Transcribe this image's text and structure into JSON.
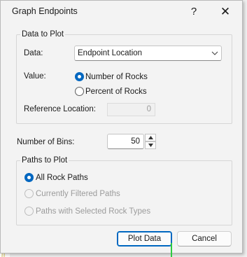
{
  "dialog": {
    "title": "Graph Endpoints",
    "help_glyph": "?",
    "close_glyph": "✕"
  },
  "data_to_plot": {
    "group_label": "Data to Plot",
    "data_label": "Data:",
    "data_selected": "Endpoint Location",
    "value_label": "Value:",
    "value_options": [
      "Number of Rocks",
      "Percent of Rocks"
    ],
    "value_selected_index": 0,
    "reference_label": "Reference Location:",
    "reference_value": "0"
  },
  "bins": {
    "label": "Number of Bins:",
    "value": "50"
  },
  "paths_to_plot": {
    "group_label": "Paths to Plot",
    "options": [
      {
        "label": "All Rock Paths",
        "selected": true,
        "enabled": true
      },
      {
        "label": "Currently Filtered Paths",
        "selected": false,
        "enabled": false
      },
      {
        "label": "Paths with Selected Rock Types",
        "selected": false,
        "enabled": false
      }
    ]
  },
  "buttons": {
    "plot": "Plot Data",
    "cancel": "Cancel"
  },
  "colors": {
    "accent": "#0067c0",
    "background_strokes": "#c23a5a"
  },
  "icons": {
    "combo_arrow": "chevron-down-icon",
    "spin_up": "caret-up-icon",
    "spin_down": "caret-down-icon"
  }
}
